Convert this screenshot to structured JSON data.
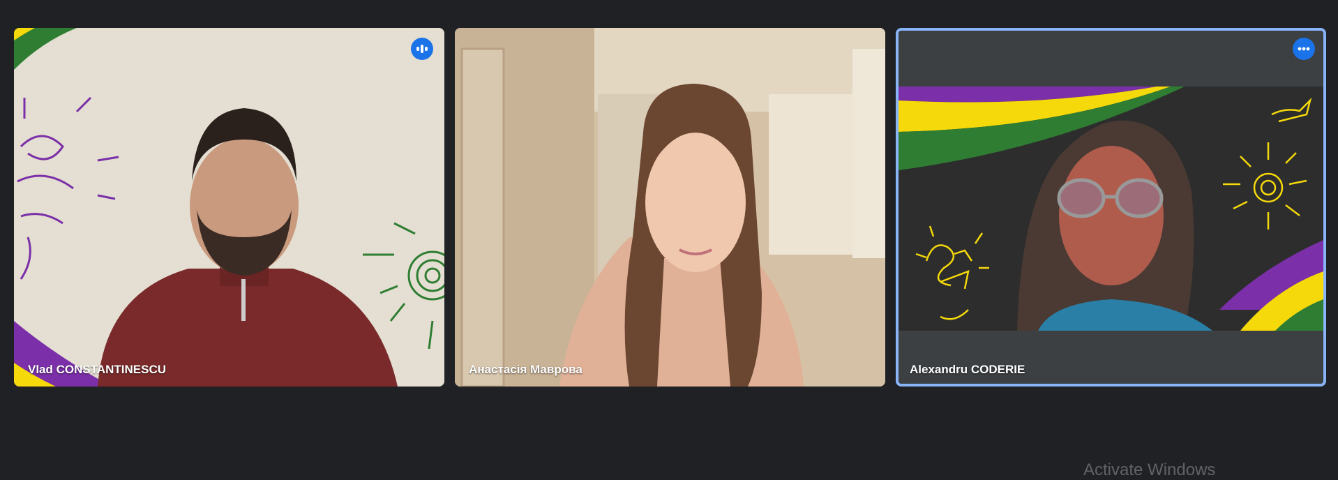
{
  "meeting": {
    "participants": [
      {
        "name": "Vlad CONSTANTINESCU",
        "status_icon": "speaking-indicator-icon"
      },
      {
        "name": "Анастасія Маврова"
      },
      {
        "name": "Alexandru CODERIE",
        "status_icon": "more-options-icon",
        "active": true
      }
    ]
  },
  "watermark": {
    "text": "Activate Windows"
  },
  "colors": {
    "background": "#202124",
    "active_border": "#8ab4f8",
    "badge": "#1a73e8",
    "brand_purple": "#7b2fa8",
    "brand_yellow": "#f5d90a",
    "brand_green": "#2e7d32"
  }
}
